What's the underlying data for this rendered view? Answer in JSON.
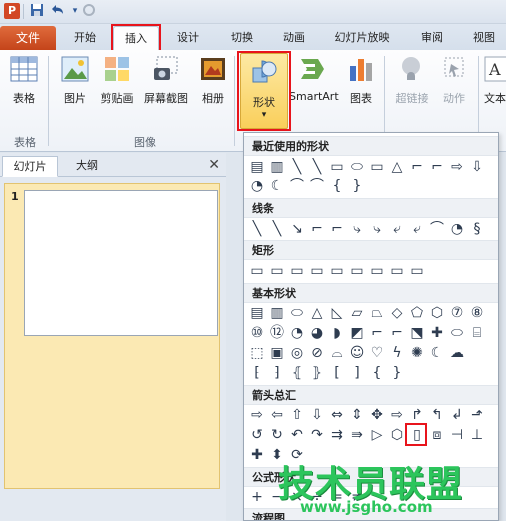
{
  "titlebar": {
    "app_icon": "P",
    "save_icon": "save-icon",
    "undo_icon": "undo-icon",
    "redo_icon": "redo-icon"
  },
  "tabs": {
    "file": "文件",
    "items": [
      {
        "label": "开始"
      },
      {
        "label": "插入"
      },
      {
        "label": "设计"
      },
      {
        "label": "切换"
      },
      {
        "label": "动画"
      },
      {
        "label": "幻灯片放映"
      },
      {
        "label": "审阅"
      },
      {
        "label": "视图"
      }
    ]
  },
  "ribbon": {
    "buttons": [
      {
        "label": "表格"
      },
      {
        "label": "图片"
      },
      {
        "label": "剪贴画"
      },
      {
        "label": "屏幕截图"
      },
      {
        "label": "相册"
      },
      {
        "label": "形状"
      },
      {
        "label": "SmartArt"
      },
      {
        "label": "图表"
      },
      {
        "label": "超链接"
      },
      {
        "label": "动作"
      },
      {
        "label": "文本"
      }
    ],
    "groups": [
      {
        "label": "表格"
      },
      {
        "label": "图像"
      }
    ]
  },
  "left_pane": {
    "tabs": [
      {
        "label": "幻灯片"
      },
      {
        "label": "大纲"
      }
    ],
    "close": "✕",
    "slide_number": "1"
  },
  "shapes_menu": {
    "sections": [
      {
        "title": "最近使用的形状"
      },
      {
        "title": "线条"
      },
      {
        "title": "矩形"
      },
      {
        "title": "基本形状"
      },
      {
        "title": "箭头总汇"
      },
      {
        "title": "公式形状"
      },
      {
        "title": "流程图"
      }
    ],
    "recent_row1": [
      "▤",
      "▥",
      "╲",
      "╲",
      "▭",
      "⬭",
      "▭",
      "△",
      "⌐",
      "⌐",
      "⇨",
      "⇩"
    ],
    "recent_row2": [
      "◔",
      "☾",
      "⌒",
      "⌒",
      "{",
      "}"
    ],
    "lines": [
      "╲",
      "╲",
      "↘",
      "⌐",
      "⌐",
      "⤷",
      "⤷",
      "⤶",
      "⤶",
      "⌒",
      "◔",
      "§"
    ],
    "rects": [
      "▭",
      "▭",
      "▭",
      "▭",
      "▭",
      "▭",
      "▭",
      "▭",
      "▭"
    ],
    "basic_row1": [
      "▤",
      "▥",
      "⬭",
      "△",
      "◺",
      "▱",
      "⏢",
      "◇",
      "⬠",
      "⬡",
      "⑦",
      "⑧"
    ],
    "basic_row2": [
      "⑩",
      "⑫",
      "◔",
      "◕",
      "◗",
      "◩",
      "⌐",
      "⌐",
      "⬔",
      "✚",
      "⬭",
      "⌸"
    ],
    "basic_row3": [
      "⬚",
      "▣",
      "◎",
      "⊘",
      "⌓",
      "☺",
      "♡",
      "ϟ",
      "✺",
      "☾",
      "☁"
    ],
    "basic_row4": [
      "⁅",
      "⁆",
      "⦃",
      "⦄",
      "[",
      "]",
      "{",
      "}"
    ],
    "arrows_row1": [
      "⇨",
      "⇦",
      "⇧",
      "⇩",
      "⇔",
      "⇕",
      "✥",
      "⇨",
      "↱",
      "↰",
      "↲",
      "⬏"
    ],
    "arrows_row2": [
      "↺",
      "↻",
      "↶",
      "↷",
      "⇉",
      "⇛",
      "▷",
      "⬡",
      "▯",
      "⧈",
      "⊣",
      "⊥"
    ],
    "arrows_row3": [
      "✚",
      "⬍",
      "⟳"
    ],
    "formula": [
      "+",
      "−",
      "×",
      "÷",
      "=",
      "≠"
    ]
  },
  "watermark": {
    "main": "技术员联盟",
    "url": "www.jsgho.com"
  },
  "colors": {
    "file_tab": "#c4441a",
    "highlight": "#e8141c",
    "watermark": "#2cc55c"
  }
}
